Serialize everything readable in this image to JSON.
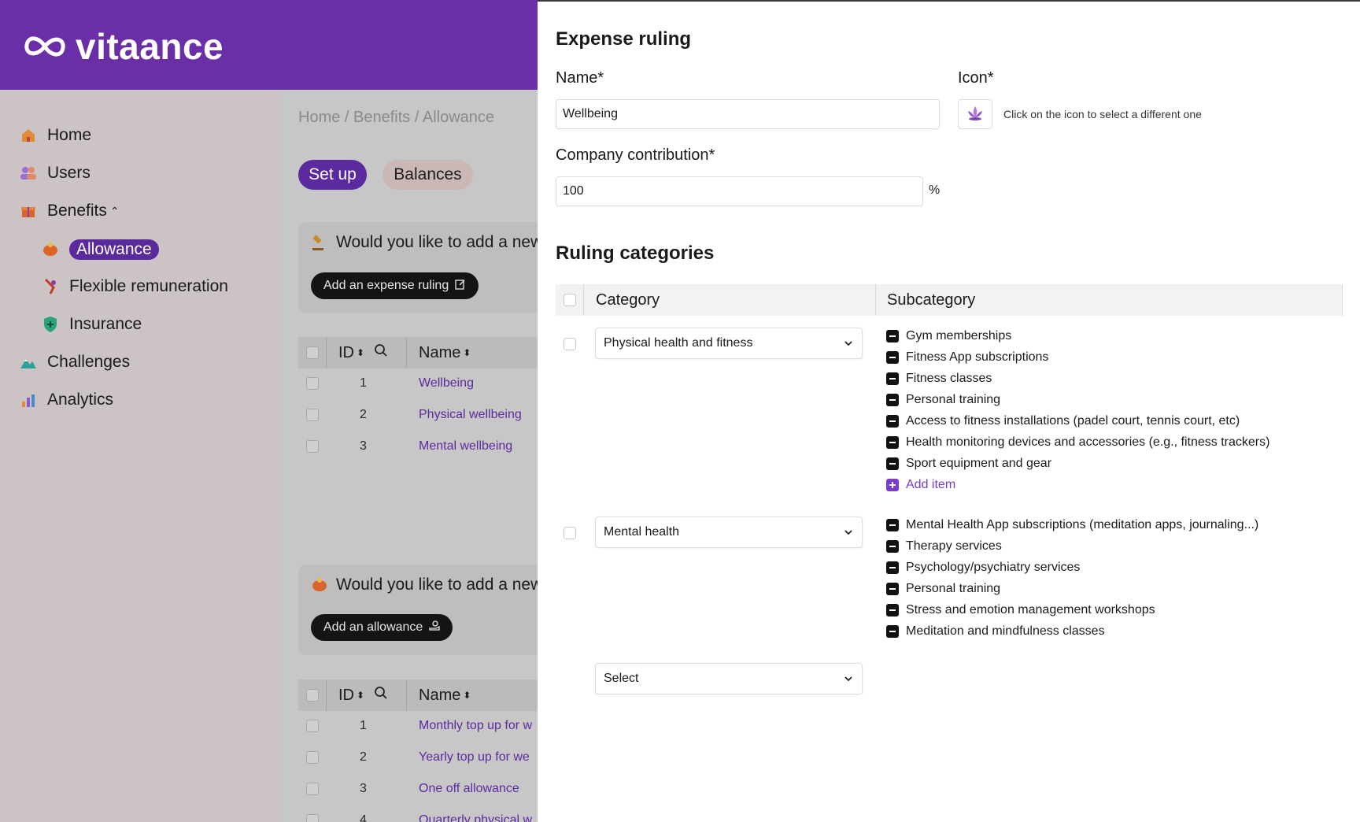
{
  "app": {
    "brand": "vitaance",
    "brand_color": "#6a2ea7"
  },
  "sidebar": {
    "items": [
      {
        "label": "Home",
        "icon": "home-icon"
      },
      {
        "label": "Users",
        "icon": "users-icon"
      },
      {
        "label": "Benefits",
        "icon": "gift-icon"
      },
      {
        "label": "Allowance",
        "icon": "piggy-bank-icon",
        "active": true
      },
      {
        "label": "Flexible remuneration",
        "icon": "flexible-icon"
      },
      {
        "label": "Insurance",
        "icon": "shield-icon"
      },
      {
        "label": "Challenges",
        "icon": "mountain-icon"
      },
      {
        "label": "Analytics",
        "icon": "bar-chart-icon"
      }
    ]
  },
  "main": {
    "breadcrumb": "Home / Benefits / Allowance",
    "tabs": [
      {
        "label": "Set up",
        "active": true
      },
      {
        "label": "Balances",
        "active": false
      }
    ],
    "ruling_promo": {
      "text": "Would you like to add a new",
      "button": "Add an expense ruling"
    },
    "allowance_promo": {
      "text": "Would you like to add a new",
      "button": "Add an allowance"
    },
    "table_headers": {
      "id": "ID",
      "name": "Name"
    },
    "rulings": [
      {
        "id": "1",
        "name": "Wellbeing"
      },
      {
        "id": "2",
        "name": "Physical wellbeing"
      },
      {
        "id": "3",
        "name": "Mental wellbeing"
      }
    ],
    "allowances": [
      {
        "id": "1",
        "name": "Monthly top up for w"
      },
      {
        "id": "2",
        "name": "Yearly top up for we"
      },
      {
        "id": "3",
        "name": "One off allowance"
      },
      {
        "id": "4",
        "name": "Quarterly physical w"
      }
    ]
  },
  "drawer": {
    "title": "Expense ruling",
    "name_label": "Name*",
    "name_value": "Wellbeing",
    "icon_label": "Icon*",
    "icon_name": "lotus-icon",
    "icon_hint": "Click on the icon to select a different one",
    "contribution_label": "Company contribution*",
    "contribution_value": "100",
    "contribution_unit": "%",
    "section_title": "Ruling categories",
    "columns": {
      "category": "Category",
      "subcategory": "Subcategory"
    },
    "categories": [
      {
        "category": "Physical health and fitness",
        "subcategories": [
          "Gym memberships",
          "Fitness App subscriptions",
          "Fitness classes",
          "Personal training",
          "Access to fitness installations (padel court, tennis court, etc)",
          "Health monitoring devices and accessories (e.g., fitness trackers)",
          "Sport equipment and gear"
        ],
        "add_label": "Add item"
      },
      {
        "category": "Mental health",
        "subcategories": [
          "Mental Health App subscriptions (meditation apps, journaling...)",
          "Therapy services",
          "Psychology/psychiatry services",
          "Personal training",
          "Stress and emotion management workshops",
          "Meditation and mindfulness classes"
        ]
      }
    ],
    "empty_select": "Select",
    "accent_color": "#7a3cc9"
  }
}
